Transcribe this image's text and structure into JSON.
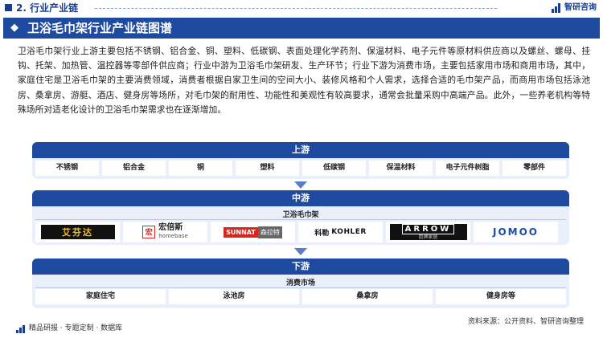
{
  "header": {
    "section_title": "2. 行业产业链",
    "brand_name": "智研咨询"
  },
  "title_bar": {
    "title": "卫浴毛巾架行业产业链图谱"
  },
  "intro": {
    "text": "卫浴毛巾架行业上游主要包括不锈钢、铝合金、铜、塑料、低碳钢、表面处理化学药剂、保温材料、电子元件等原材料供应商以及螺丝、螺母、挂钩、托架、加热管、温控器等零部件供应商；行业中游为卫浴毛巾架研发、生产环节；行业下游为消费市场，主要包括家用市场和商用市场，其中，家庭住宅是卫浴毛巾架的主要消费领域，消费者根据自家卫生间的空间大小、装修风格和个人需求，选择合适的毛巾架产品，而商用市场包括泳池房、桑拿房、游艇、酒店、健身房等场所，对毛巾架的耐用性、功能性和美观性有较高要求，通常会批量采购中高端产品。此外，一些养老机构等特殊场所对适老化设计的卫浴毛巾架需求也在逐渐增加。"
  },
  "upstream": {
    "label": "上游",
    "items": [
      "不锈钢",
      "铝合金",
      "铜",
      "塑料",
      "低碳钢",
      "保温材料",
      "电子元件树脂",
      "零部件"
    ]
  },
  "midstream": {
    "label": "中游",
    "sublabel": "卫浴毛巾架",
    "logos": {
      "artist": "艾芬达",
      "homebase_cn": "宏倍斯",
      "homebase_en": "homebase",
      "homebase_mark": "宏",
      "sunnat_en": "SUNNAT",
      "sunnat_cn": "森拉特",
      "kohler_cn": "科勒",
      "kohler_en": "KOHLER",
      "arrow_en": "ARROW",
      "arrow_cn": "箭牌家居",
      "jomoo": "JOMOO"
    }
  },
  "downstream": {
    "label": "下游",
    "sublabel": "消费市场",
    "items": [
      "家庭住宅",
      "泳池房",
      "桑拿房",
      "健身房等"
    ]
  },
  "footer": {
    "left": "精品研报 · 专题定制 · 数据库",
    "right": "资料来源：公开资料、智研咨询整理"
  },
  "watermark": "智研咨询"
}
